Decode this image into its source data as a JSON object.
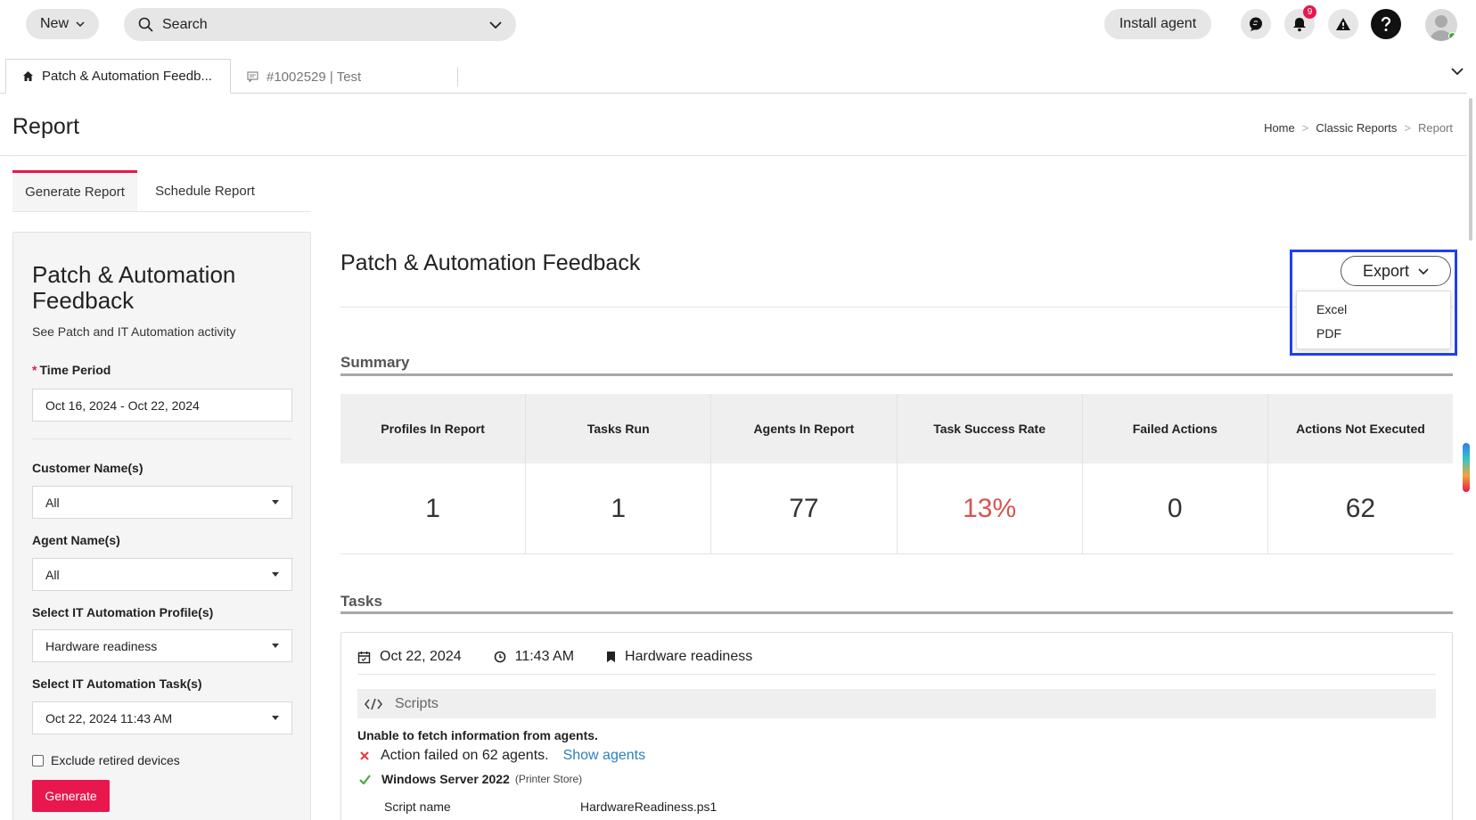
{
  "topbar": {
    "new_label": "New",
    "search_placeholder": "Search",
    "install_label": "Install agent",
    "notification_count": "9"
  },
  "tabs": [
    {
      "label": "Patch & Automation Feedb..."
    },
    {
      "label": "#1002529 | Test"
    }
  ],
  "page": {
    "title": "Report",
    "breadcrumb": [
      "Home",
      "Classic Reports",
      "Report"
    ]
  },
  "subtabs": [
    "Generate Report",
    "Schedule Report"
  ],
  "panel": {
    "title": "Patch & Automation Feedback",
    "subtitle": "See Patch and IT Automation activity",
    "time_period_label": "Time Period",
    "time_period_value": "Oct 16, 2024 - Oct 22, 2024",
    "customer_label": "Customer Name(s)",
    "customer_value": "All",
    "agent_label": "Agent Name(s)",
    "agent_value": "All",
    "profile_label": "Select IT Automation Profile(s)",
    "profile_value": "Hardware readiness",
    "task_label": "Select IT Automation Task(s)",
    "task_value": "Oct 22, 2024 11:43 AM",
    "exclude_label": "Exclude retired devices",
    "generate_label": "Generate"
  },
  "report": {
    "title": "Patch & Automation Feedback",
    "export_label": "Export",
    "export_options": [
      "Excel",
      "PDF"
    ],
    "summary_heading": "Summary",
    "summary": [
      {
        "label": "Profiles In Report",
        "value": "1"
      },
      {
        "label": "Tasks Run",
        "value": "1"
      },
      {
        "label": "Agents In Report",
        "value": "77"
      },
      {
        "label": "Task Success Rate",
        "value": "13%"
      },
      {
        "label": "Failed Actions",
        "value": "0"
      },
      {
        "label": "Actions Not Executed",
        "value": "62"
      }
    ],
    "tasks_heading": "Tasks",
    "task": {
      "date": "Oct 22, 2024",
      "time": "11:43 AM",
      "profile": "Hardware readiness",
      "scripts_label": "Scripts",
      "message": "Unable to fetch information from agents.",
      "fail_text": "Action failed on 62 agents.",
      "show_agents": "Show agents",
      "os_name": "Windows Server 2022",
      "os_note": "(Printer Store)",
      "script_name_label": "Script name",
      "script_name_value": "HardwareReadiness.ps1"
    }
  },
  "colors": {
    "accent": "#e8174d",
    "highlight": "#1f3ff2",
    "alert": "#d9534f",
    "link": "#2a7fc1"
  }
}
